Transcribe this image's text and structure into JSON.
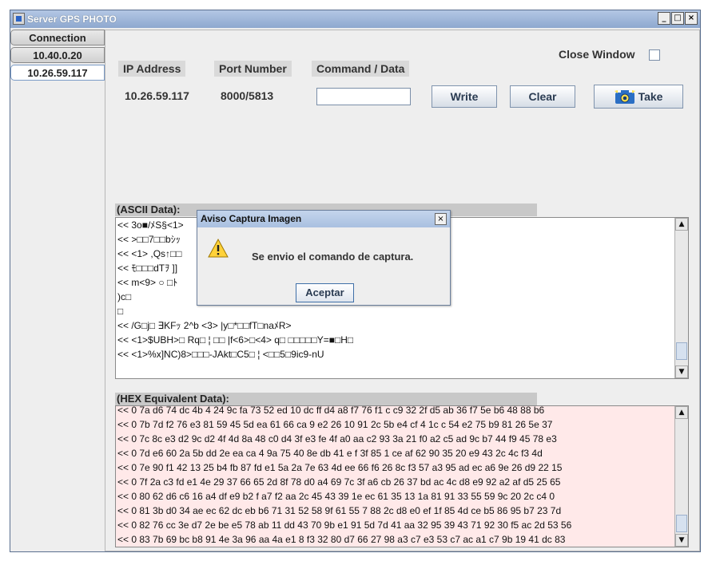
{
  "window": {
    "title": "Server GPS PHOTO",
    "minimize": "_",
    "maximize": "□",
    "close": "×"
  },
  "tabs": [
    {
      "label": "Connection"
    },
    {
      "label": "10.40.0.20"
    },
    {
      "label": "10.26.59.117",
      "active": true
    }
  ],
  "connection": {
    "ip_label": "IP Address",
    "ip_value": "10.26.59.117",
    "port_label": "Port Number",
    "port_value": "8000/5813",
    "command_label": "Command / Data",
    "command_value": "",
    "close_window_label": "Close Window",
    "close_window_checked": false
  },
  "buttons": {
    "write": "Write",
    "clear": "Clear",
    "take": "Take"
  },
  "ascii": {
    "label": "(ASCII Data):",
    "lines": [
      "<< 3o■/ﾒS§<1>",
      "<< >□□7□□bｼｯ",
      "<< <1> ,Qs↑□□",
      "<< ﾓ□□□dTｦ ]]",
      "<< m<9> ○ □ﾄ",
      ")c□",
      " □",
      "<< /G□j□ ∃KFｯ 2^b  <3> |y□*□□fT□naﾒR>",
      "<< <1>$UBH>□ Rq□ ¦ □□ |f<6>□<4>  q□  □□□□□Y=■□H□",
      "<< <1>%x]NC)8>□□□-JAkt□C5□ ¦ <□□5□9ic9-nU"
    ]
  },
  "hex": {
    "label": "(HEX Equivalent Data):",
    "lines": [
      "<< 0 7a d6 74 dc 4b 4 24 9c fa 73 52 ed 10 dc ff d4 a8 f7 76 f1 c c9 32 2f d5 ab 36 f7 5e b6 48 88 b6",
      "<< 0 7b 7d f2 76 e3 81 59 45 5d ea 61 66 ca 9 e2 26 10 91 2c 5b e4 cf 4 1c c 54 e2 75 b9 81 26 5e 37",
      "<< 0 7c 8c e3 d2 9c d2 4f 4d 8a 48 c0 d4 3f e3 fe 4f a0 aa c2 93 3a 21 f0 a2 c5 ad 9c b7 44 f9 45 78 e3",
      "<< 0 7d e6 60 2a 5b dd 2e ea ca 4 9a 75 40 8e db 41 e f 3f 85 1 ce af 62 90 35 20 e9 43 2c 4c f3 4d",
      "<< 0 7e 90 f1 42 13 25 b4 fb 87 fd e1 5a 2a 7e 63 4d ee 66 f6 26 8c f3 57 a3 95 ad ec a6 9e 26 d9 22 15",
      "<< 0 7f 2a c3 fd e1 4e 29 37 66 65 2d 8f 78 d0 a4 69 7c 3f a6 cb 26 37 bd ac 4c d8 e9 92 a2 af d5 25 65",
      "<< 0 80 62 d6 c6 16 a4 df e9 b2 f a7 f2 aa 2c 45 43 39 1e ec 61 35 13 1a 81 91 33 55 59 9c 20 2c c4 0",
      "<< 0 81 3b d0 34 ae ec 62 dc eb b6 71 31 52 58 9f 61 55 7 88 2c d8 e0 ef 1f 85 4d ce b5 86 95 b7 23 7d",
      "<< 0 82 76 cc 3e d7 2e be e5 78 ab 11 dd 43 70 9b e1 91 5d 7d 41 aa 32 95 39 43 71 92 30 f5 ac 2d 53 56",
      "<< 0 83 7b 69 bc b8 91 4e 3a 96 aa 4a e1 8 f3 32 80 d7 66 27 98 a3 c7 e3 53 c7 ac a1 c7 9b 19 41 dc 83"
    ]
  },
  "dialog": {
    "title": "Aviso Captura Imagen",
    "close": "×",
    "message": "Se envio el comando de captura.",
    "ok_label": "Aceptar"
  },
  "scroll": {
    "up": "▲",
    "down": "▼"
  }
}
